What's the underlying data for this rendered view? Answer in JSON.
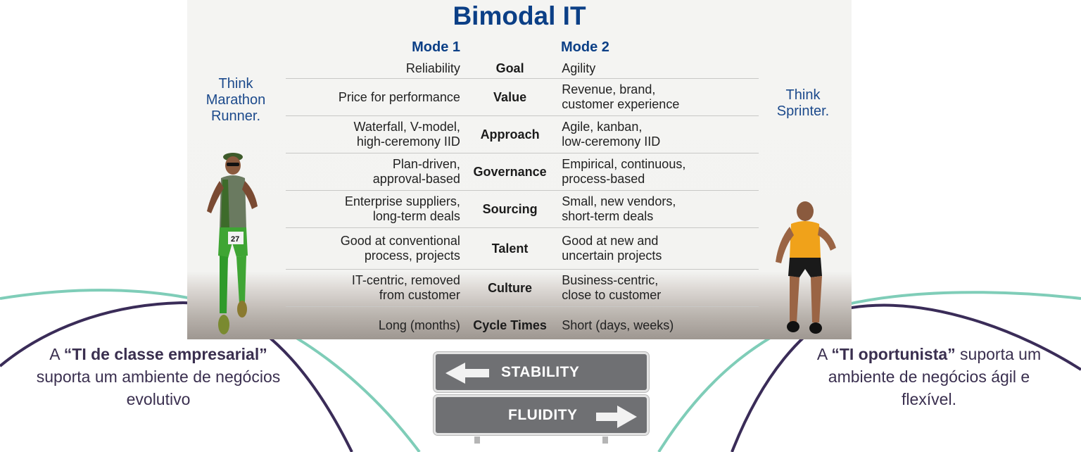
{
  "slide": {
    "title": "Bimodal IT",
    "mode1_label": "Mode 1",
    "mode2_label": "Mode 2",
    "think_left": [
      "Think",
      "Marathon",
      "Runner."
    ],
    "think_right": [
      "Think",
      "Sprinter."
    ],
    "rows": [
      {
        "mode1": [
          "Reliability"
        ],
        "aspect": "Goal",
        "mode2": [
          "Agility"
        ]
      },
      {
        "mode1": [
          "Price for performance"
        ],
        "aspect": "Value",
        "mode2": [
          "Revenue, brand,",
          "customer experience"
        ]
      },
      {
        "mode1": [
          "Waterfall, V-model,",
          "high-ceremony IID"
        ],
        "aspect": "Approach",
        "mode2": [
          "Agile, kanban,",
          "low-ceremony IID"
        ]
      },
      {
        "mode1": [
          "Plan-driven,",
          "approval-based"
        ],
        "aspect": "Governance",
        "mode2": [
          "Empirical, continuous,",
          "process-based"
        ]
      },
      {
        "mode1": [
          "Enterprise suppliers,",
          "long-term deals"
        ],
        "aspect": "Sourcing",
        "mode2": [
          "Small, new vendors,",
          "short-term deals"
        ]
      },
      {
        "mode1": [
          "Good at conventional",
          "process, projects"
        ],
        "aspect": "Talent",
        "mode2": [
          "Good at new and",
          "uncertain projects"
        ]
      },
      {
        "mode1": [
          "IT-centric, removed",
          "from customer"
        ],
        "aspect": "Culture",
        "mode2": [
          "Business-centric,",
          "close to customer"
        ]
      },
      {
        "mode1": [
          "Long (months)"
        ],
        "aspect": "Cycle Times",
        "mode2": [
          "Short (days, weeks)"
        ]
      }
    ],
    "marathon_runner_bib": "27",
    "images": [
      "marathon-runner-photo",
      "sprinter-photo"
    ]
  },
  "sign": {
    "top_label": "STABILITY",
    "top_direction": "left",
    "bottom_label": "FLUIDITY",
    "bottom_direction": "right"
  },
  "captions": {
    "left": {
      "prefix": "A ",
      "bold": "“TI de classe empresarial”",
      "suffix": " suporta um ambiente de negócios evolutivo"
    },
    "right": {
      "prefix": "A ",
      "bold": "“TI oportunista”",
      "suffix": " suporta um ambiente de negócios ágil e flexível."
    }
  },
  "colors": {
    "title_blue": "#0b3f86",
    "curve_teal": "#7fcdb8",
    "curve_purple": "#3a2c58",
    "caption_text": "#3a2f4f",
    "sign_gray": "#6f7073"
  }
}
